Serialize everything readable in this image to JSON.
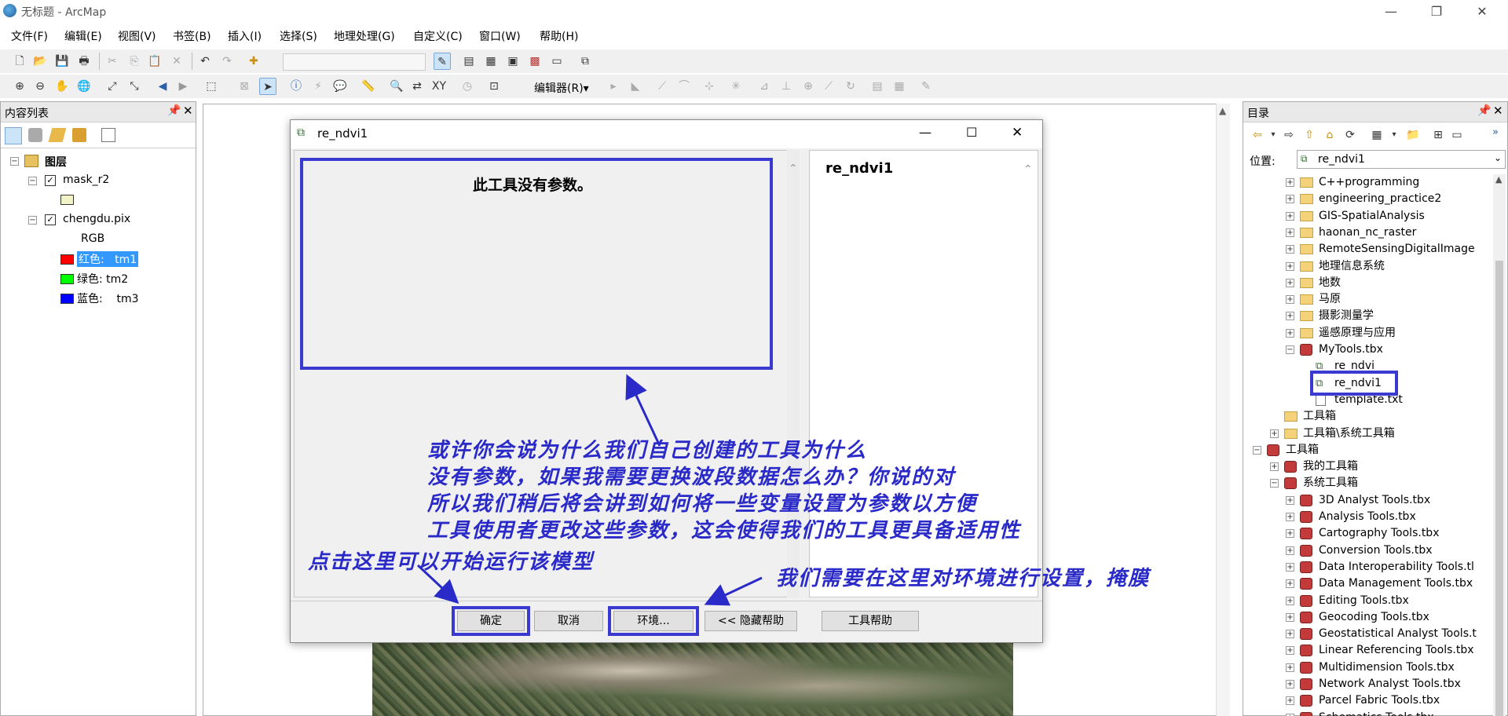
{
  "window": {
    "title": "无标题 - ArcMap"
  },
  "menu": [
    "文件(F)",
    "编辑(E)",
    "视图(V)",
    "书签(B)",
    "插入(I)",
    "选择(S)",
    "地理处理(G)",
    "自定义(C)",
    "窗口(W)",
    "帮助(H)"
  ],
  "toolbar2": {
    "editor_label": "编辑器(R)▾"
  },
  "toc": {
    "title": "内容列表",
    "root": "图层",
    "layer1": "mask_r2",
    "layer2": "chengdu.pix",
    "rgb": "RGB",
    "bands": [
      {
        "label": "红色:",
        "value": "tm1",
        "color": "#ff0000"
      },
      {
        "label": "绿色:",
        "value": "tm2",
        "color": "#00ff00"
      },
      {
        "label": "蓝色:",
        "value": "tm3",
        "color": "#0000ff"
      }
    ]
  },
  "catalog": {
    "title": "目录",
    "location_label": "位置:",
    "location_value": "re_ndvi1",
    "items": [
      {
        "text": "C++programming",
        "icon": "folder-icon",
        "level": 2,
        "pm": "+"
      },
      {
        "text": "engineering_practice2",
        "icon": "folder-icon",
        "level": 2,
        "pm": "+"
      },
      {
        "text": "GIS-SpatialAnalysis",
        "icon": "folder-icon",
        "level": 2,
        "pm": "+"
      },
      {
        "text": "haonan_nc_raster",
        "icon": "folder-icon",
        "level": 2,
        "pm": "+"
      },
      {
        "text": "RemoteSensingDigitalImage",
        "icon": "folder-icon",
        "level": 2,
        "pm": "+"
      },
      {
        "text": "地理信息系统",
        "icon": "folder-icon",
        "level": 2,
        "pm": "+"
      },
      {
        "text": "地数",
        "icon": "folder-icon",
        "level": 2,
        "pm": "+"
      },
      {
        "text": "马原",
        "icon": "folder-icon",
        "level": 2,
        "pm": "+"
      },
      {
        "text": "摄影测量学",
        "icon": "folder-icon",
        "level": 2,
        "pm": "+"
      },
      {
        "text": "遥感原理与应用",
        "icon": "folder-icon",
        "level": 2,
        "pm": "+"
      },
      {
        "text": "MyTools.tbx",
        "icon": "toolbox-icon",
        "level": 2,
        "pm": "−"
      },
      {
        "text": "re_ndvi",
        "icon": "model-icon",
        "level": 3,
        "pm": ""
      },
      {
        "text": "re_ndvi1",
        "icon": "model-icon",
        "level": 3,
        "pm": "",
        "selected": true
      },
      {
        "text": "template.txt",
        "icon": "file-icon",
        "level": 3,
        "pm": ""
      },
      {
        "text": "工具箱",
        "icon": "folder-icon",
        "level": 1,
        "pm": ""
      },
      {
        "text": "工具箱\\系统工具箱",
        "icon": "folder-icon",
        "level": 1,
        "pm": "+"
      },
      {
        "text": "工具箱",
        "icon": "toolbox-icon",
        "level": 0,
        "pm": "−"
      },
      {
        "text": "我的工具箱",
        "icon": "toolbox-icon",
        "level": 1,
        "pm": "+"
      },
      {
        "text": "系统工具箱",
        "icon": "toolbox-icon",
        "level": 1,
        "pm": "−"
      },
      {
        "text": "3D Analyst Tools.tbx",
        "icon": "toolbox-icon",
        "level": 2,
        "pm": "+"
      },
      {
        "text": "Analysis Tools.tbx",
        "icon": "toolbox-icon",
        "level": 2,
        "pm": "+"
      },
      {
        "text": "Cartography Tools.tbx",
        "icon": "toolbox-icon",
        "level": 2,
        "pm": "+"
      },
      {
        "text": "Conversion Tools.tbx",
        "icon": "toolbox-icon",
        "level": 2,
        "pm": "+"
      },
      {
        "text": "Data Interoperability Tools.tl",
        "icon": "toolbox-icon",
        "level": 2,
        "pm": "+"
      },
      {
        "text": "Data Management Tools.tbx",
        "icon": "toolbox-icon",
        "level": 2,
        "pm": "+"
      },
      {
        "text": "Editing Tools.tbx",
        "icon": "toolbox-icon",
        "level": 2,
        "pm": "+"
      },
      {
        "text": "Geocoding Tools.tbx",
        "icon": "toolbox-icon",
        "level": 2,
        "pm": "+"
      },
      {
        "text": "Geostatistical Analyst Tools.t",
        "icon": "toolbox-icon",
        "level": 2,
        "pm": "+"
      },
      {
        "text": "Linear Referencing Tools.tbx",
        "icon": "toolbox-icon",
        "level": 2,
        "pm": "+"
      },
      {
        "text": "Multidimension Tools.tbx",
        "icon": "toolbox-icon",
        "level": 2,
        "pm": "+"
      },
      {
        "text": "Network Analyst Tools.tbx",
        "icon": "toolbox-icon",
        "level": 2,
        "pm": "+"
      },
      {
        "text": "Parcel Fabric Tools.tbx",
        "icon": "toolbox-icon",
        "level": 2,
        "pm": "+"
      },
      {
        "text": "Schematics Tools.tbx",
        "icon": "toolbox-icon",
        "level": 2,
        "pm": "+"
      }
    ]
  },
  "dialog": {
    "title": "re_ndvi1",
    "no_params": "此工具没有参数。",
    "help_title": "re_ndvi1",
    "ok": "确定",
    "cancel": "取消",
    "env": "环境...",
    "hide_help": "<< 隐藏帮助",
    "tool_help": "工具帮助"
  },
  "annotations": {
    "line1": "或许你会说为什么我们自己创建的工具为什么",
    "line2": "没有参数，如果我需要更换波段数据怎么办？你说的对",
    "line3": "所以我们稍后将会讲到如何将一些变量设置为参数以方便",
    "line4": "工具使用者更改这些参数，这会使得我们的工具更具备适用性",
    "run_hint": "点击这里可以开始运行该模型",
    "env_hint": "我们需要在这里对环境进行设置，掩膜"
  },
  "colors": {
    "annotation": "#2a2ac8",
    "selection": "#3399ff"
  }
}
